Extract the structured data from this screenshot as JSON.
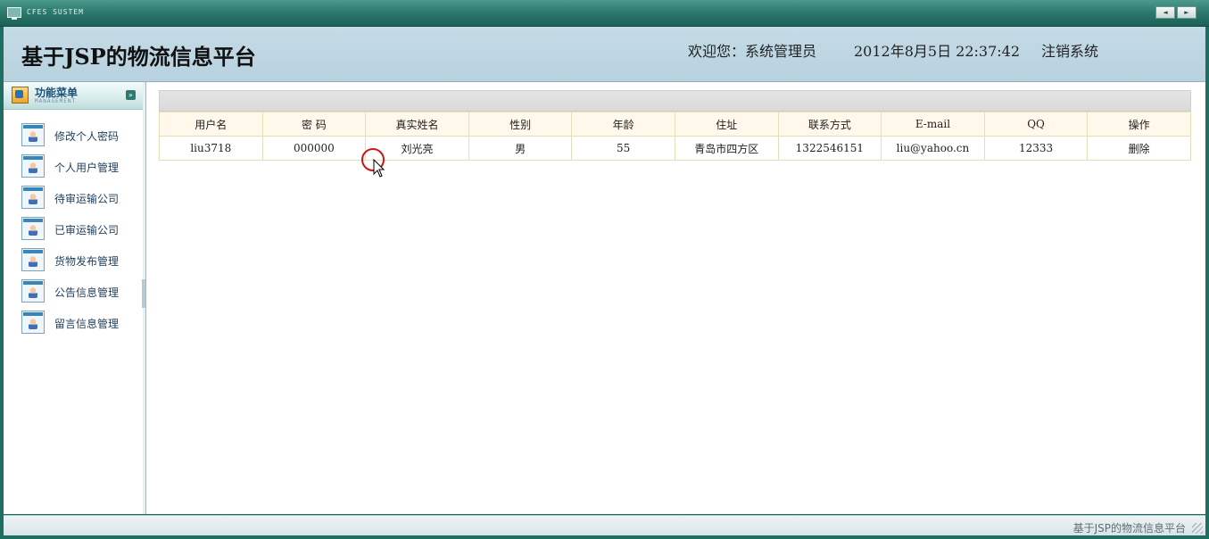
{
  "system_bar": {
    "title": "CFES SUSTEM",
    "nav": [
      "◄",
      "►"
    ]
  },
  "header": {
    "app_title": "基于JSP的物流信息平台",
    "welcome": "欢迎您：系统管理员",
    "datetime": "2012年8月5日  22:37:42",
    "logout_label": "注销系统"
  },
  "sidebar": {
    "title": "功能菜单",
    "subtitle": "MANAGEMENT",
    "collapse_glyph": "»",
    "items": [
      {
        "label": "修改个人密码"
      },
      {
        "label": "个人用户管理"
      },
      {
        "label": "待审运输公司"
      },
      {
        "label": "已审运输公司"
      },
      {
        "label": "货物发布管理"
      },
      {
        "label": "公告信息管理"
      },
      {
        "label": "留言信息管理"
      }
    ]
  },
  "table": {
    "columns": [
      "用户名",
      "密  码",
      "真实姓名",
      "性别",
      "年龄",
      "住址",
      "联系方式",
      "E-mail",
      "QQ",
      "操作"
    ],
    "rows": [
      [
        "liu3718",
        "000000",
        "刘光亮",
        "男",
        "55",
        "青岛市四方区",
        "1322546151",
        "liu@yahoo.cn",
        "12333",
        "删除"
      ]
    ]
  },
  "footer": {
    "text": "基于JSP的物流信息平台"
  }
}
